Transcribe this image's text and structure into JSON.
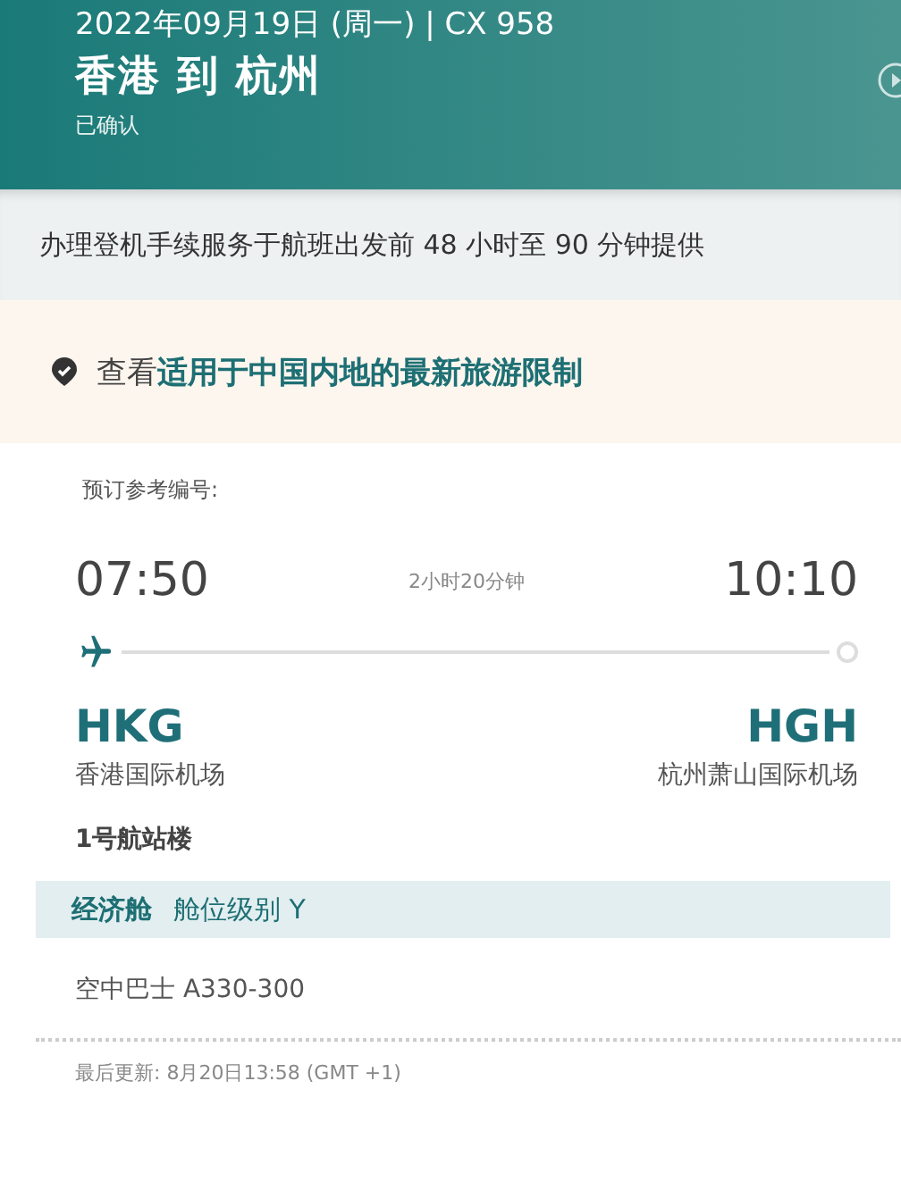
{
  "header": {
    "date_flight": "2022年09月19日 (周一) | CX 958",
    "route": "香港 到 杭州",
    "status": "已确认"
  },
  "checkin_notice": "办理登机手续服务于航班出发前 48 小时至 90 分钟提供",
  "travel_notice": {
    "prefix": "查看",
    "link": "适用于中国内地的最新旅游限制"
  },
  "booking": {
    "reference_label": "预订参考编号:"
  },
  "flight": {
    "departure_time": "07:50",
    "duration": "2小时20分钟",
    "arrival_time": "10:10",
    "origin_code": "HKG",
    "destination_code": "HGH",
    "origin_airport": "香港国际机场",
    "destination_airport": "杭州萧山国际机场",
    "terminal": "1号航站楼"
  },
  "cabin": {
    "class": "经济舱",
    "fare_class": "舱位级别 Y"
  },
  "aircraft": "空中巴士 A330-300",
  "last_updated": "最后更新: 8月20日13:58 (GMT +1)"
}
